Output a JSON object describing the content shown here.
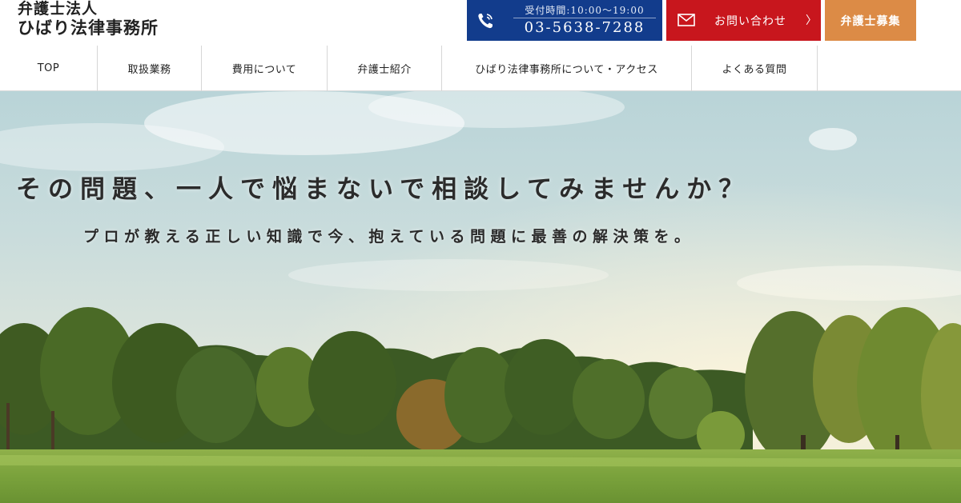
{
  "logo": {
    "line1": "弁護士法人",
    "line2": "ひばり法律事務所"
  },
  "header": {
    "tel": {
      "hours": "受付時間:10:00〜19:00",
      "number": "03-5638-7288",
      "icon": "phone-icon",
      "color": "#123c8c"
    },
    "contact": {
      "label": "お問い合わせ",
      "chevron": "〉",
      "icon": "mail-icon",
      "color": "#c8161d"
    },
    "recruit": {
      "label": "弁護士募集",
      "color": "#dc8b46"
    }
  },
  "nav": {
    "items": [
      {
        "label": "TOP"
      },
      {
        "label": "取扱業務"
      },
      {
        "label": "費用について"
      },
      {
        "label": "弁護士紹介"
      },
      {
        "label": "ひばり法律事務所について・アクセス"
      },
      {
        "label": "よくある質問"
      }
    ]
  },
  "hero": {
    "title": "その問題、一人で悩まないで相談してみませんか？",
    "subtitle": "プロが教える正しい知識で今、抱えている問題に最善の解決策を。"
  }
}
